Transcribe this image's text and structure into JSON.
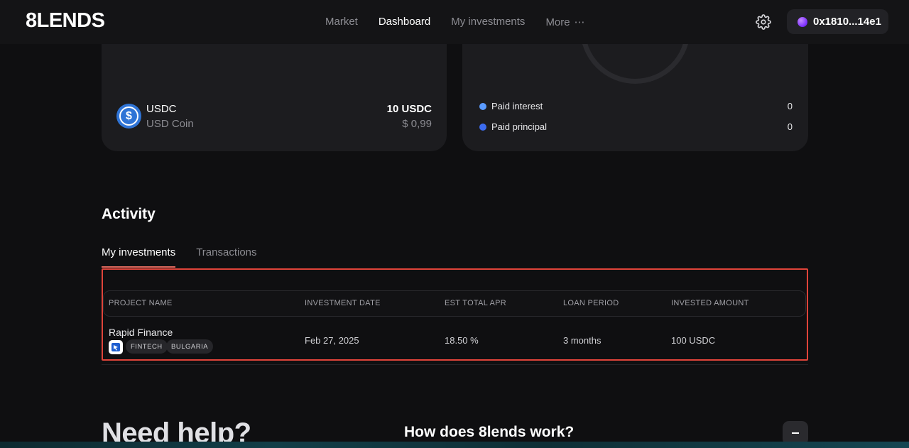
{
  "nav": {
    "logo": "8LENDS",
    "items": [
      {
        "label": "Market",
        "active": false
      },
      {
        "label": "Dashboard",
        "active": true
      },
      {
        "label": "My investments",
        "active": false
      },
      {
        "label": "More",
        "active": false
      }
    ],
    "more_icon": "⋯",
    "settings_icon": "gear-icon",
    "wallet_address": "0x1810...14e1"
  },
  "asset_card": {
    "symbol": "USDC",
    "name": "USD Coin",
    "amount": "10 USDC",
    "usd_value": "$ 0,99",
    "icon": "usdc-icon"
  },
  "returns_card": {
    "legend": [
      {
        "label": "Paid interest",
        "value": "0",
        "color": "#5a9bff"
      },
      {
        "label": "Paid principal",
        "value": "0",
        "color": "#3c6cf0"
      }
    ]
  },
  "activity": {
    "title": "Activity",
    "tabs": [
      {
        "label": "My investments",
        "active": true
      },
      {
        "label": "Transactions",
        "active": false
      }
    ],
    "columns": [
      "PROJECT NAME",
      "INVESTMENT DATE",
      "EST TOTAL APR",
      "LOAN PERIOD",
      "INVESTED AMOUNT"
    ],
    "rows": [
      {
        "project": "Rapid Finance",
        "tags": [
          "FINTECH",
          "BULGARIA"
        ],
        "date": "Feb 27, 2025",
        "apr": "18.50 %",
        "period": "3 months",
        "amount": "100 USDC"
      }
    ]
  },
  "help": {
    "title": "Need help?",
    "faq_question": "How does 8lends work?",
    "toggle_symbol": "−"
  },
  "colors": {
    "accent_tab": "#e06a5e",
    "highlight_border": "#e0443a",
    "wallet_dot": "#7a2bff"
  }
}
